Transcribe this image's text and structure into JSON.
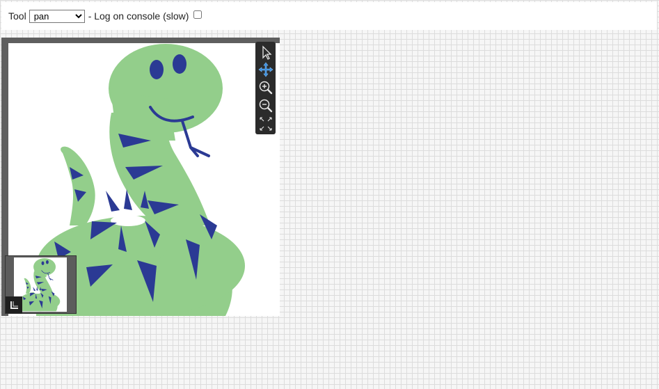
{
  "header": {
    "tool_label": "Tool",
    "tool_selected": "pan",
    "tool_options": [
      "pan"
    ],
    "log_label": "- Log on console (slow)",
    "log_checked": false
  },
  "viewer": {
    "image_name": "snake",
    "toolbar": {
      "tools": [
        {
          "name": "select-tool",
          "icon": "cursor-arrow-icon",
          "active": false
        },
        {
          "name": "pan-tool",
          "icon": "move-arrows-icon",
          "active": true
        },
        {
          "name": "zoom-in-tool",
          "icon": "zoom-in-icon",
          "active": false
        },
        {
          "name": "zoom-out-tool",
          "icon": "zoom-out-icon",
          "active": false
        },
        {
          "name": "fit-tool",
          "icon": "fit-to-screen-icon",
          "active": false
        }
      ]
    },
    "minimap": {
      "toggle_icon": "collapse-corner-icon"
    }
  },
  "colors": {
    "snake_green": "#93ce8b",
    "stripe_blue": "#2b3a94",
    "toolbar_bg": "#2b2b2b",
    "active_tool": "#3a8dde",
    "viewer_frame": "#5f5f5f"
  }
}
